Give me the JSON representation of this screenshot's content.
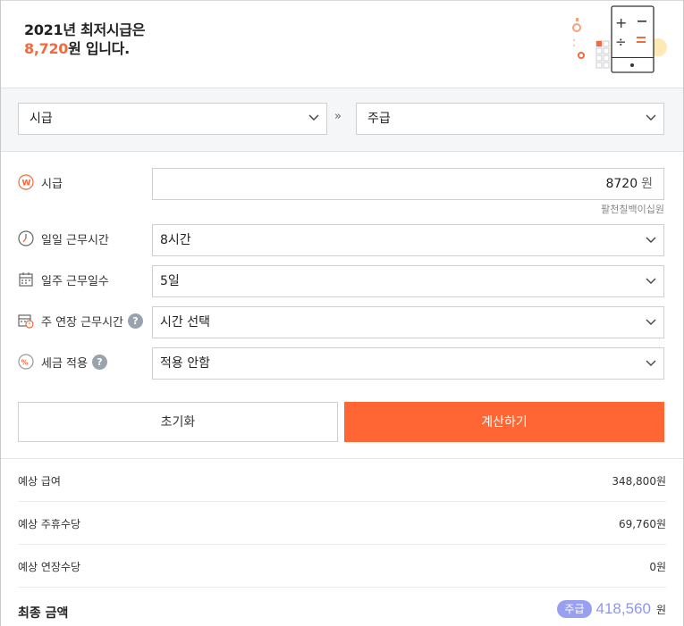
{
  "header": {
    "line1": "2021년 최저시급은",
    "amount": "8,720",
    "line2_suffix": "원 입니다."
  },
  "converter": {
    "from": "시급",
    "to": "주급",
    "arrow": "»"
  },
  "form": {
    "hourly": {
      "label": "시급",
      "value": "8720",
      "unit": "원",
      "hint": "팔천칠백이십원"
    },
    "daily_hours": {
      "label": "일일 근무시간",
      "value": "8시간"
    },
    "weekly_days": {
      "label": "일주 근무일수",
      "value": "5일"
    },
    "overtime": {
      "label": "주 연장 근무시간",
      "value": "시간 선택",
      "help": "?"
    },
    "tax": {
      "label": "세금 적용",
      "value": "적용 안함",
      "help": "?"
    }
  },
  "buttons": {
    "reset": "초기화",
    "calculate": "계산하기"
  },
  "results": {
    "rows": [
      {
        "label": "예상 급여",
        "value": "348,800원"
      },
      {
        "label": "예상 주휴수당",
        "value": "69,760원"
      },
      {
        "label": "예상 연장수당",
        "value": "0원"
      }
    ],
    "final": {
      "label": "최종 금액",
      "badge": "주급",
      "amount": "418,560",
      "unit": "원"
    }
  },
  "colors": {
    "accent": "#ff6633",
    "headline_accent": "#f26a3d",
    "final_amount": "#8f96ea"
  },
  "icons": [
    "won-icon",
    "clock-icon",
    "calendar-icon",
    "overtime-calendar-icon",
    "percent-icon",
    "chevron-down-icon",
    "help-icon",
    "calculator-illustration"
  ]
}
